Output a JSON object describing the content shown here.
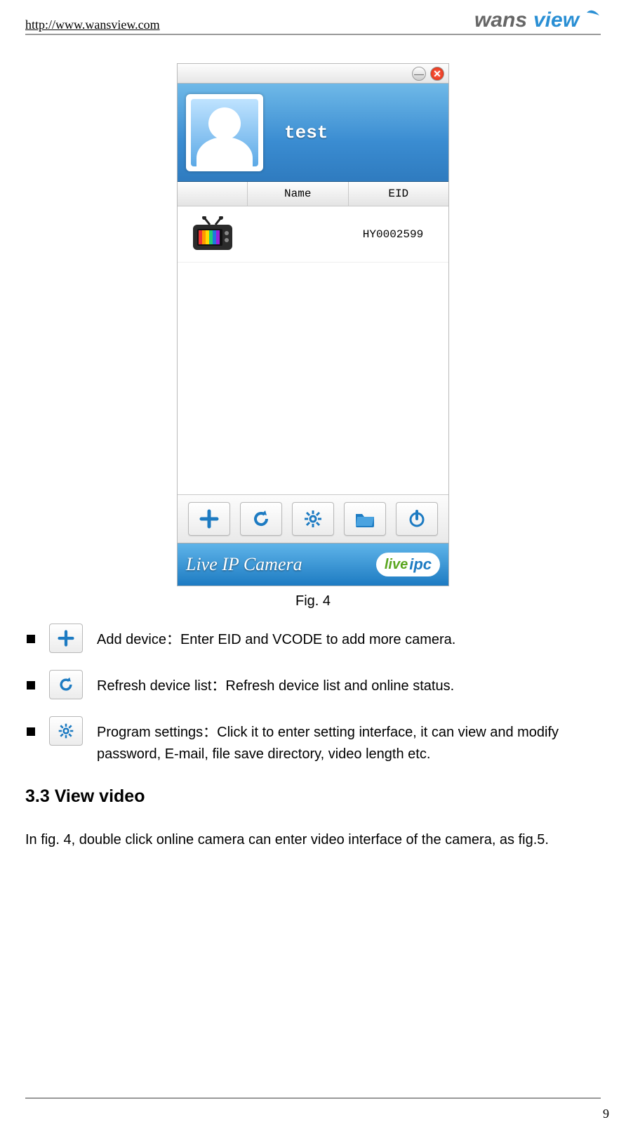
{
  "header": {
    "url": "http://www.wansview.com",
    "brand": "wansview"
  },
  "screenshot": {
    "username": "test",
    "columns": {
      "name": "Name",
      "eid": "EID"
    },
    "devices": [
      {
        "name": "",
        "eid": "HY0002599"
      }
    ],
    "toolbar_buttons": [
      {
        "id": "add",
        "icon": "plus-icon"
      },
      {
        "id": "refresh",
        "icon": "refresh-icon"
      },
      {
        "id": "settings",
        "icon": "gear-icon"
      },
      {
        "id": "open-folder",
        "icon": "folder-icon"
      },
      {
        "id": "power",
        "icon": "power-icon"
      }
    ],
    "banner": "Live IP Camera",
    "badge": {
      "live": "live",
      "ipc": "ipc"
    }
  },
  "caption": "Fig. 4",
  "bullets": [
    {
      "icon": "plus-icon",
      "text": "Add device：Enter EID and VCODE to add more camera."
    },
    {
      "icon": "refresh-icon",
      "text": "Refresh device list：Refresh device list and online status."
    },
    {
      "icon": "gear-icon",
      "text": "Program settings：Click it to enter setting interface, it can view and modify password, E-mail, file save directory, video length etc."
    }
  ],
  "section_heading": "3.3 View video",
  "section_text": "In fig. 4, double click online camera can enter video interface of the camera, as fig.5.",
  "page_number": "9"
}
